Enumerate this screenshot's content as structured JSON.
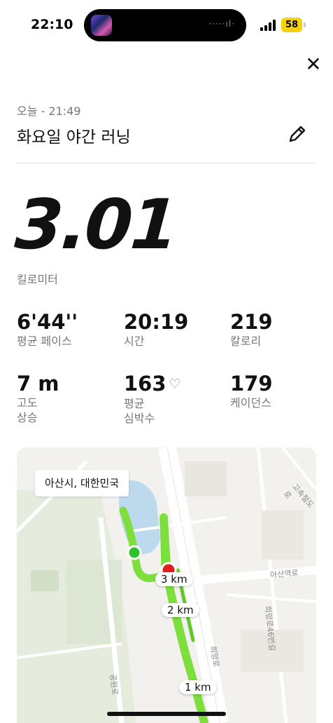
{
  "status_bar": {
    "time": "22:10",
    "battery": "58",
    "signal_icon": "cellular-signal-icon"
  },
  "header": {
    "close_icon": "close-icon",
    "date_line": "오늘 - 21:49",
    "title": "화요일 야간 러닝",
    "edit_icon": "pencil-icon"
  },
  "summary": {
    "distance": "3.01",
    "distance_unit": "킬로미터"
  },
  "stats": [
    {
      "value": "6'44''",
      "label": "평균 페이스"
    },
    {
      "value": "20:19",
      "label": "시간"
    },
    {
      "value": "219",
      "label": "칼로리"
    },
    {
      "value": "7 m",
      "label_line1": "고도",
      "label_line2": "상승"
    },
    {
      "value": "163",
      "heart": "♡",
      "label_line1": "평균",
      "label_line2": "심박수"
    },
    {
      "value": "179",
      "label": "케이던스"
    }
  ],
  "map": {
    "location": "아산시, 대한민국",
    "km_markers": [
      "3 km",
      "2 km",
      "1 km"
    ],
    "road_labels": [
      "아산역로",
      "희망로",
      "희망로46번길",
      "공원로",
      "고속철도로"
    ],
    "colors": {
      "route": "#7ddf3c",
      "start": "#2ec12e",
      "end": "#e01e1e",
      "water": "#bcd9ee",
      "park": "#dfe8d3"
    }
  }
}
